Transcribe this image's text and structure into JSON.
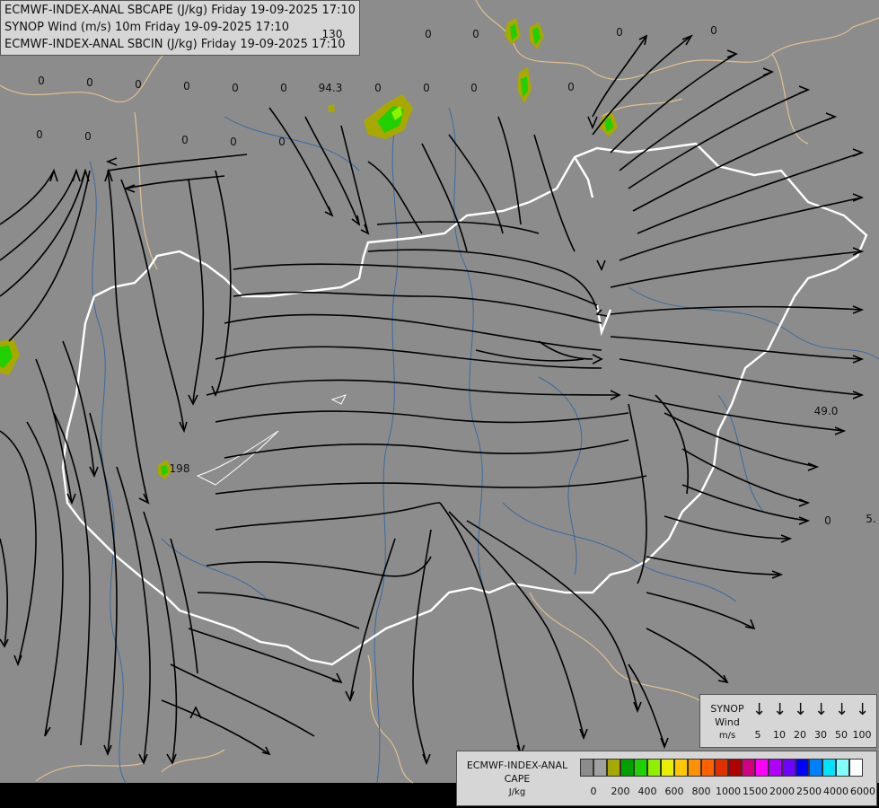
{
  "header": {
    "line1": "ECMWF-INDEX-ANAL SBCAPE (J/kg) Friday 19-09-2025 17:10",
    "line2": "SYNOP Wind (m/s) 10m Friday 19-09-2025 17:10",
    "line3": "ECMWF-INDEX-ANAL SBCIN (J/kg) Friday 19-09-2025 17:10"
  },
  "map_values": [
    "0",
    "0",
    "0",
    "0",
    "0",
    "0",
    "0",
    "0",
    "0",
    "0",
    "0",
    "0",
    "0",
    "0",
    "0",
    "0",
    "0",
    "0",
    "0",
    "0",
    "94.3",
    "130",
    "198",
    "49.0",
    "5."
  ],
  "legend_wind": {
    "title1": "SYNOP",
    "title2": "Wind",
    "unit": "m/s",
    "arrow_glyph": "↓",
    "speeds": [
      "5",
      "10",
      "20",
      "30",
      "50",
      "100"
    ]
  },
  "legend_cape": {
    "title1": "ECMWF-INDEX-ANAL",
    "title2": "CAPE",
    "unit": "J/kg",
    "ticks": [
      "0",
      "200",
      "400",
      "600",
      "800",
      "1000",
      "1500",
      "2000",
      "2500",
      "4000",
      "6000"
    ],
    "colors": [
      "#8c8c8c",
      "#a0a0a0",
      "#a8a800",
      "#00a000",
      "#20d000",
      "#90f000",
      "#e8f000",
      "#ffc800",
      "#ff9000",
      "#ff6000",
      "#e03000",
      "#b00000",
      "#d00080",
      "#ff00ff",
      "#b000ff",
      "#7000ff",
      "#0000ff",
      "#0080ff",
      "#00e0ff",
      "#80ffff",
      "#ffffff"
    ]
  },
  "colors": {
    "background": "#8c8c8c",
    "streamline": "#000000",
    "border": "#ffffff",
    "rivers": "#3a6aa0",
    "neighbor_borders": "#e0c090"
  }
}
